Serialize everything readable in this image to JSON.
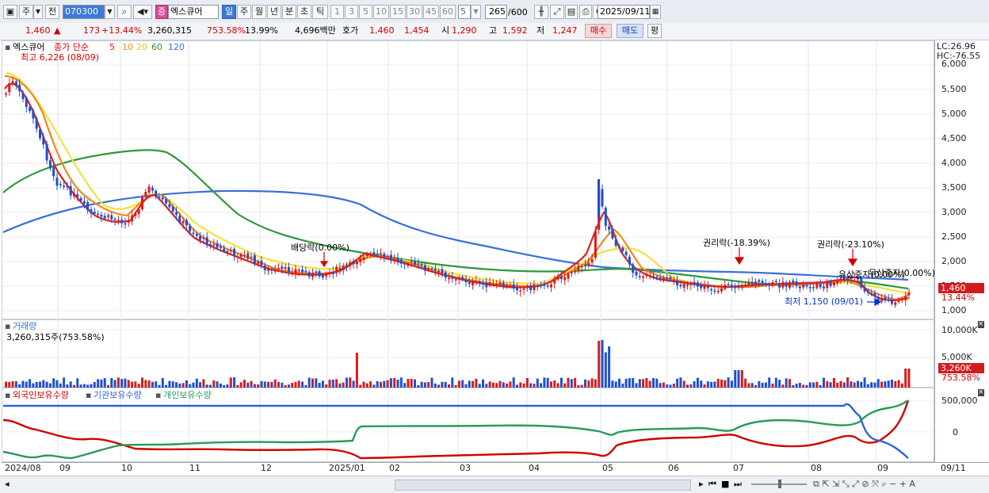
{
  "toolbar": {
    "period_week": "주",
    "prev_label": "전",
    "code": "070300",
    "stock_badge": "증",
    "stock_name": "엑스큐어",
    "tf_day": "일",
    "tf_week": "주",
    "tf_month": "월",
    "tf_year": "년",
    "tf_min": "분",
    "tf_sec": "초",
    "tf_tick": "틱",
    "intervals": [
      "1",
      "3",
      "5",
      "10",
      "15",
      "30",
      "45",
      "60"
    ],
    "count_value": "5",
    "range_value": "265",
    "range_total": "/600",
    "date_value": "2025/09/11"
  },
  "quote": {
    "price": "1,460",
    "change_arrow": "▲",
    "change": "173",
    "change_pct": "+13.44%",
    "volume": "3,260,315",
    "volume_ratio": "753.58%",
    "turnover": "13.99%",
    "amount": "4,696백만",
    "bid_label": "호가",
    "bid": "1,460",
    "ask": "1,454",
    "open_label": "시",
    "open": "1,290",
    "high_label": "고",
    "high": "1,592",
    "low_label": "저",
    "low": "1,247",
    "buy_label": "매수",
    "sell_label": "매도",
    "avg_label": "평"
  },
  "price_panel": {
    "name": "엑스큐어",
    "ma_label": "종가 단순",
    "ma_periods": [
      "5",
      "10",
      "20",
      "60",
      "120"
    ],
    "ma_colors": [
      "#e0201c",
      "#f08a1c",
      "#f2e23c",
      "#2a9a3a",
      "#3a6fd8"
    ],
    "high_note": "최고 6,226 (08/09)",
    "low_note": "최저 1,150 (09/01)",
    "annotations": [
      "배당락(0.00%)",
      "권리락(-18.39%)",
      "권리락(-23.10%)",
      "유상증자(0.00%)",
      "무상증자(0.00%)"
    ],
    "lc": "LC:26.96",
    "hc": "HC:-76.55",
    "y_ticks": [
      "6,000",
      "5,500",
      "5,000",
      "4,500",
      "4,000",
      "3,500",
      "3,000",
      "2,500",
      "2,000",
      "1,500",
      "1,000"
    ],
    "last_price": "1,460",
    "last_pct": "13.44%"
  },
  "volume_panel": {
    "title": "거래량",
    "info": "3,260,315주(753.58%)",
    "y_ticks": [
      "10,000K",
      "5,000K"
    ],
    "last": "3,260K",
    "last_pct": "753.58%"
  },
  "holding_panel": {
    "legend": [
      "외국인보유수량",
      "기관보유수량",
      "개인보유수량"
    ],
    "legend_colors": [
      "#d00000",
      "#2a62d8",
      "#2a9a5a"
    ],
    "y_ticks": [
      "500,000",
      "0"
    ]
  },
  "x_axis": [
    "2024/08",
    "09",
    "10",
    "11",
    "12",
    "2025/01",
    "02",
    "03",
    "04",
    "05",
    "06",
    "07",
    "08",
    "09"
  ],
  "x_axis_last": "09/11"
}
